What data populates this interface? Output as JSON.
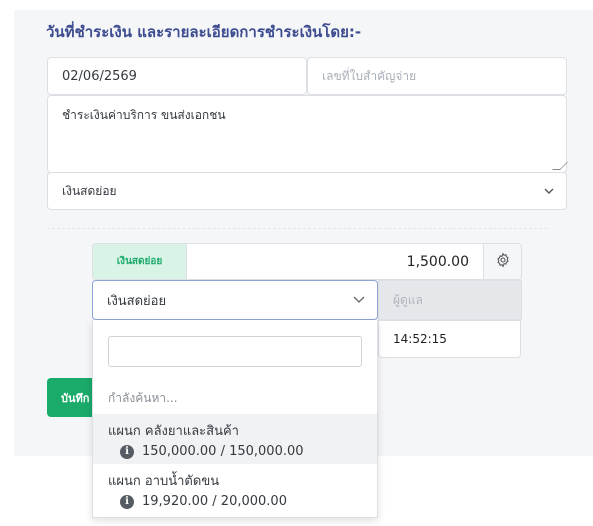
{
  "section": {
    "title": "วันที่ชำระเงิน และรายละเอียดการชำระเงินโดย:-"
  },
  "form": {
    "date_value": "02/06/2569",
    "doc_placeholder": "เลขที่ใบสำคัญจ่าย",
    "description_value": "ชำระเงินค่าบริการ ขนส่งเอกชน",
    "method_selected": "เงินสดย่อย"
  },
  "payment": {
    "tag_label": "เงินสดย่อย",
    "amount": "1,500.00",
    "department_selected": "เงินสดย่อย",
    "owner_placeholder": "ผู้ดูแล",
    "time_value": "14:52:15"
  },
  "save_button": {
    "label": "บันทึก"
  },
  "dropdown": {
    "search_value": "",
    "searching_text": "กำลังค้นหา...",
    "options": [
      {
        "name": "แผนก คลังยาและสินค้า",
        "balance": "150,000.00 / 150,000.00"
      },
      {
        "name": "แผนก อาบน้ำตัดขน",
        "balance": "19,920.00 / 20,000.00"
      }
    ]
  },
  "colors": {
    "title": "#3d4b8f",
    "accent_green": "#1aaa6a",
    "tag_bg": "#d9f4e6",
    "focus_border": "#8fa3d6"
  },
  "icons": {
    "method_chevron": "chevron-down-icon",
    "settings": "gear-icon",
    "info": "info-icon"
  }
}
